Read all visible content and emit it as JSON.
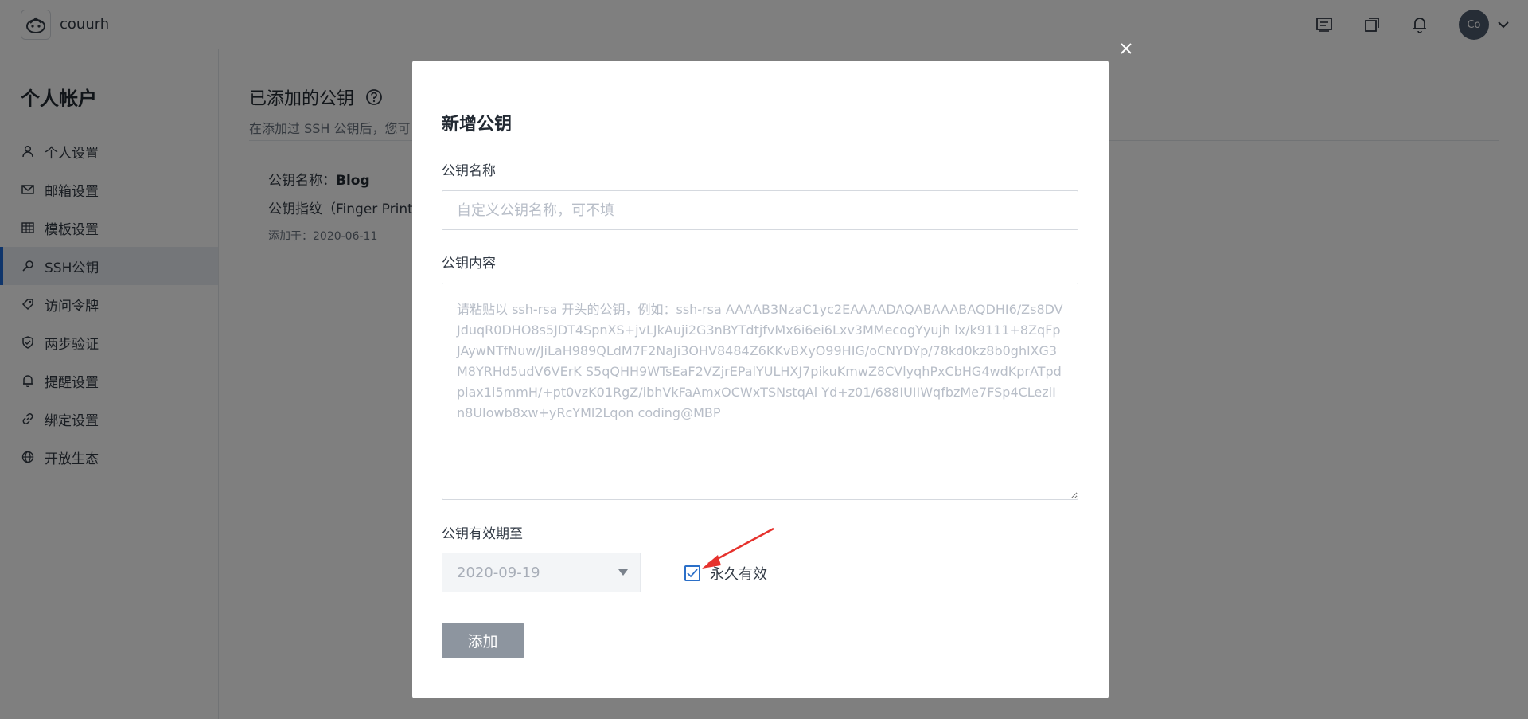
{
  "topbar": {
    "team_name": "couurh",
    "avatar_initials": "Co",
    "icons": [
      "ticket-icon",
      "copy-icon",
      "bell-icon",
      "chevron-down-icon"
    ]
  },
  "sidebar": {
    "title": "个人帐户",
    "items": [
      {
        "label": "个人设置",
        "icon": "user-icon"
      },
      {
        "label": "邮箱设置",
        "icon": "mail-icon"
      },
      {
        "label": "模板设置",
        "icon": "grid-icon"
      },
      {
        "label": "SSH公钥",
        "icon": "key-icon",
        "active": true
      },
      {
        "label": "访问令牌",
        "icon": "tag-icon"
      },
      {
        "label": "两步验证",
        "icon": "shield-icon"
      },
      {
        "label": "提醒设置",
        "icon": "bell-icon"
      },
      {
        "label": "绑定设置",
        "icon": "link-icon"
      },
      {
        "label": "开放生态",
        "icon": "globe-icon"
      }
    ],
    "accent_color": "#1e6bd6"
  },
  "content": {
    "title": "已添加的公钥",
    "description": "在添加过 SSH 公钥后，您可",
    "key": {
      "name_label": "公钥名称：",
      "name_value": "Blog",
      "fingerprint_label": "公钥指纹（Finger Print）",
      "added_date": "添加于：2020-06-11"
    }
  },
  "modal": {
    "title": "新增公钥",
    "name_label": "公钥名称",
    "name_placeholder": "自定义公钥名称，可不填",
    "content_label": "公钥内容",
    "content_placeholder": "请粘贴以 ssh-rsa 开头的公钥，例如：ssh-rsa AAAAB3NzaC1yc2EAAAADAQABAAABAQDHI6/Zs8DVJduqR0DHO8s5JDT4SpnXS+jvLJkAuji2G3nBYTdtjfvMx6i6ei6Lxv3MMecogYyujh lx/k9111+8ZqFpJAywNTfNuw/JiLaH989QLdM7F2NaJi3OHV8484Z6KKvBXyO99HIG/oCNYDYp/78kd0kz8b0ghlXG3M8YRHd5udV6VErK S5qQHH9WTsEaF2VZjrEPalYULHXJ7pikuKmwZ8CVlyqhPxCbHG4wdKprATpdpiax1i5mmH/+pt0vzK01RgZ/ibhVkFaAmxOCWxTSNstqAl Yd+z01/688IUIIWqfbzMe7FSp4CLezlIn8UIowb8xw+yRcYMl2Lqon coding@MBP",
    "expiry_label": "公钥有效期至",
    "expiry_date": "2020-09-19",
    "permanent_label": "永久有效",
    "permanent_checked": true,
    "add_button_label": "添加",
    "close_icon": "close-icon",
    "arrow_color": "#e6322d"
  }
}
